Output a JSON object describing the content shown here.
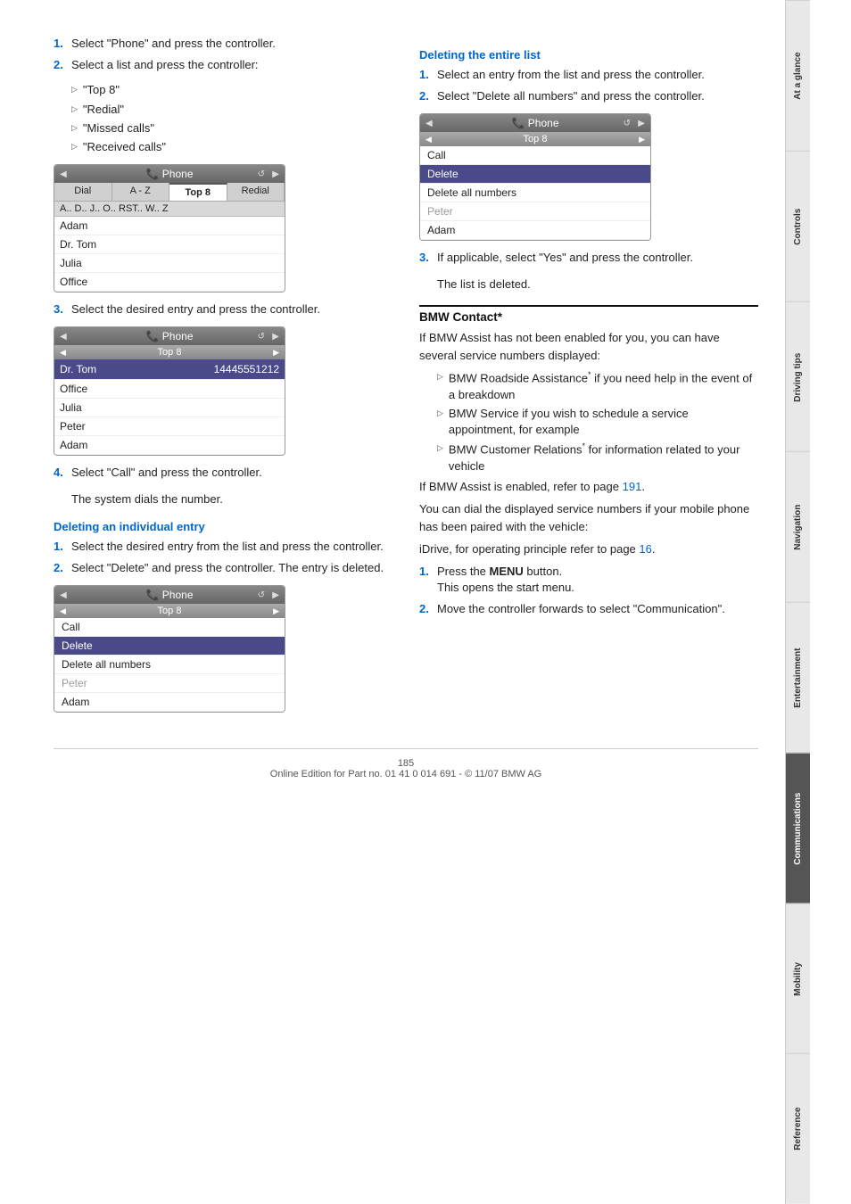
{
  "sidebar": {
    "tabs": [
      {
        "label": "At a glance",
        "active": false
      },
      {
        "label": "Controls",
        "active": false
      },
      {
        "label": "Driving tips",
        "active": false
      },
      {
        "label": "Navigation",
        "active": false
      },
      {
        "label": "Entertainment",
        "active": false
      },
      {
        "label": "Communications",
        "active": true
      },
      {
        "label": "Mobility",
        "active": false
      },
      {
        "label": "Reference",
        "active": false
      }
    ]
  },
  "left_col": {
    "steps_top": [
      {
        "num": "1.",
        "text": "Select \"Phone\" and press the controller."
      },
      {
        "num": "2.",
        "text": "Select a list and press the controller:"
      }
    ],
    "sub_bullets": [
      "\"Top 8\"",
      "\"Redial\"",
      "\"Missed calls\"",
      "\"Received calls\""
    ],
    "phone_ui_1": {
      "header": "Phone",
      "subheader": "Top 8",
      "tabs": [
        "Dial",
        "A - Z",
        "Top 8",
        "Redial"
      ],
      "selected_tab": "Top 8",
      "tab_letters": "A..  D..  J..  O..  RST..  W..  Z",
      "rows": [
        "Adam",
        "Dr. Tom",
        "Julia",
        "Office"
      ]
    },
    "step3": {
      "num": "3.",
      "text": "Select the desired entry and press the controller."
    },
    "phone_ui_2": {
      "header": "Phone",
      "subheader": "Top 8",
      "selected_row": "Dr. Tom",
      "selected_row_num": "14445551212",
      "rows": [
        "Office",
        "Julia",
        "Peter",
        "Adam"
      ]
    },
    "step4": {
      "num": "4.",
      "text": "Select \"Call\" and press the controller."
    },
    "step4_sub": "The system dials the number.",
    "deleting_individual": {
      "heading": "Deleting an individual entry",
      "steps": [
        {
          "num": "1.",
          "text": "Select the desired entry from the list and press the controller."
        },
        {
          "num": "2.",
          "text": "Select \"Delete\" and press the controller. The entry is deleted."
        }
      ]
    },
    "phone_ui_3": {
      "header": "Phone",
      "subheader": "Top 8",
      "rows": [
        {
          "label": "Call",
          "selected": false
        },
        {
          "label": "Delete",
          "selected": true
        },
        {
          "label": "Delete all numbers",
          "selected": false
        },
        {
          "label": "Peter",
          "greyed": true
        },
        {
          "label": "Adam",
          "greyed": false
        }
      ]
    }
  },
  "right_col": {
    "deleting_entire": {
      "heading": "Deleting the entire list",
      "steps": [
        {
          "num": "1.",
          "text": "Select an entry from the list and press the controller."
        },
        {
          "num": "2.",
          "text": "Select \"Delete all numbers\" and press the controller."
        }
      ]
    },
    "phone_ui_4": {
      "header": "Phone",
      "subheader": "Top 8",
      "rows": [
        {
          "label": "Call",
          "selected": false
        },
        {
          "label": "Delete",
          "selected": true
        },
        {
          "label": "Delete all numbers",
          "selected": false
        },
        {
          "label": "Peter",
          "greyed": true
        },
        {
          "label": "Adam",
          "greyed": false
        }
      ]
    },
    "step3": {
      "num": "3.",
      "text": "If applicable, select \"Yes\" and press the controller."
    },
    "step3_sub": "The list is deleted.",
    "bmw_contact": {
      "heading": "BMW Contact*",
      "intro": "If BMW Assist has not been enabled for you, you can have several service numbers displayed:",
      "bullets": [
        {
          "text": "BMW Roadside Assistance",
          "star": true,
          "suffix": " if you need help in the event of a breakdown"
        },
        {
          "text": "BMW Service if you wish to schedule a service appointment, for example"
        },
        {
          "text": "BMW Customer Relations",
          "star": true,
          "suffix": " for information related to your vehicle"
        }
      ],
      "assist_note": "If BMW Assist is enabled, refer to page ",
      "assist_page": "191",
      "assist_note2": ".",
      "dial_note": "You can dial the displayed service numbers if your mobile phone has been paired with the vehicle:",
      "idrive_note": "iDrive, for operating principle refer to page ",
      "idrive_page": "16",
      "idrive_note2": ".",
      "final_steps": [
        {
          "num": "1.",
          "text_before": "Press the ",
          "bold": "MENU",
          "text_after": " button.",
          "sub": "This opens the start menu."
        },
        {
          "num": "2.",
          "text": "Move the controller forwards to select \"Communication\"."
        }
      ]
    }
  },
  "footer": {
    "page_num": "185",
    "text": "Online Edition for Part no. 01 41 0 014 691 - © 11/07 BMW AG"
  }
}
